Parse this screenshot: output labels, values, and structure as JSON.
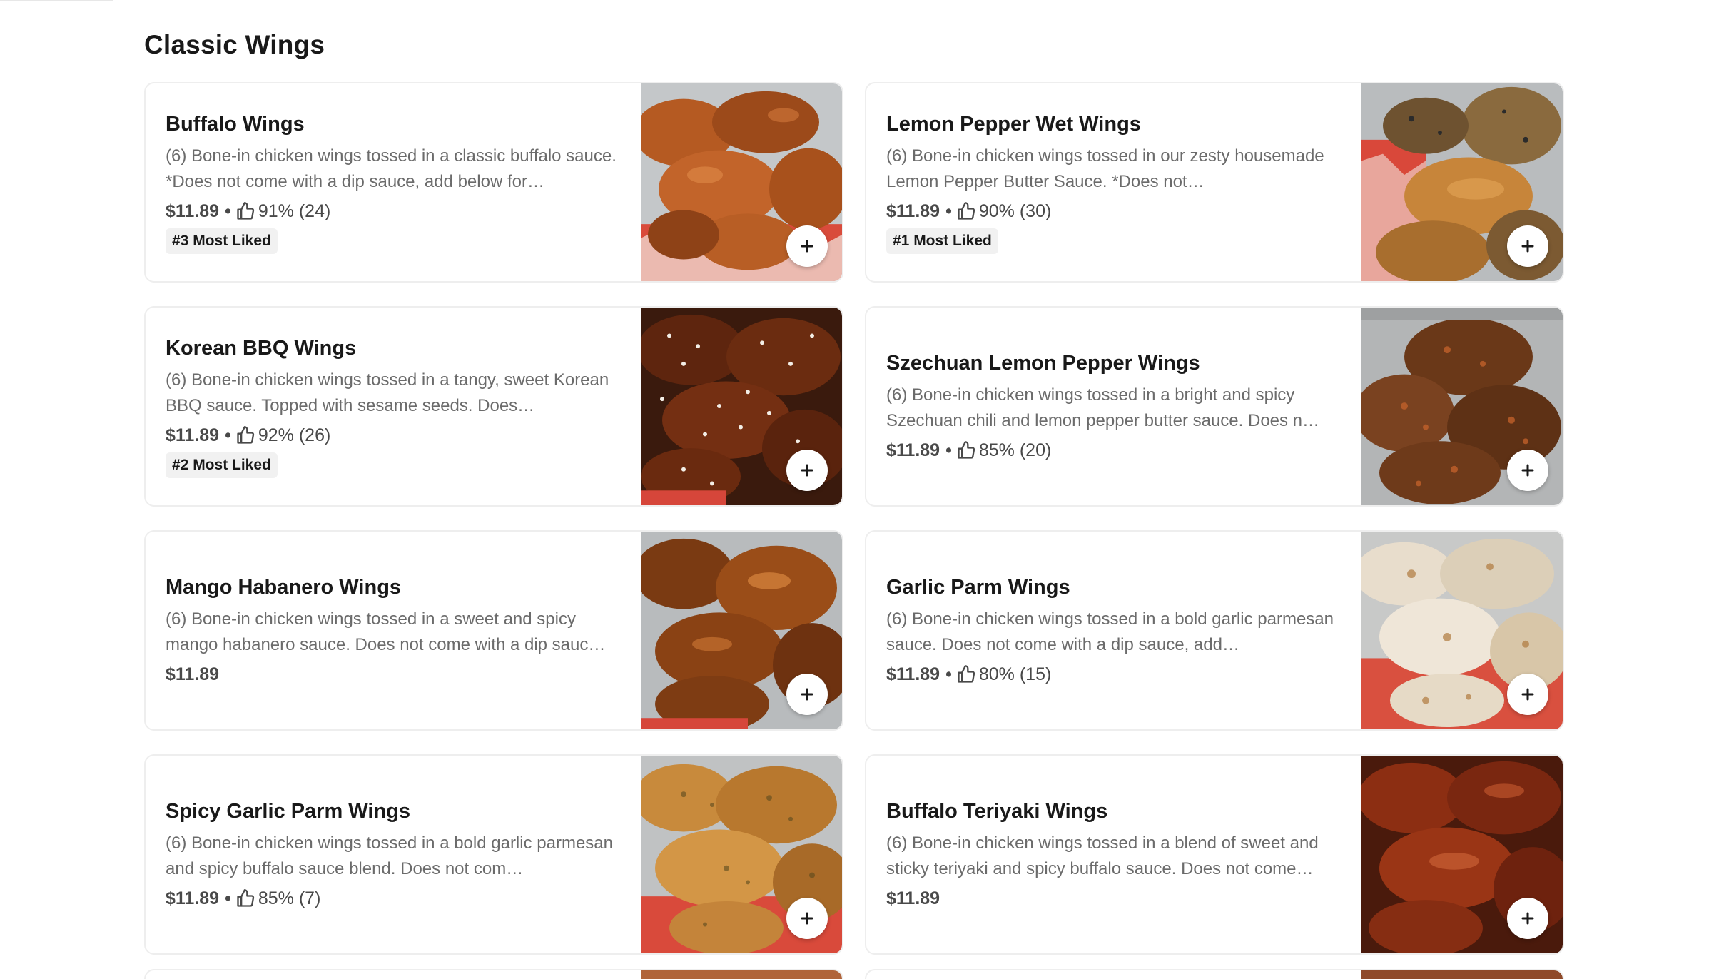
{
  "section": {
    "title": "Classic Wings"
  },
  "icons": {
    "thumb": "thumbs-up-icon",
    "add": "plus-icon"
  },
  "colors": {
    "badge_bg": "#f1f1f1",
    "text_primary": "#191919",
    "text_secondary": "#6b6b6b"
  },
  "items": [
    {
      "name": "Buffalo Wings",
      "description": "(6) Bone-in chicken wings tossed in a classic buffalo sauce. *Does not come with a dip sauce, add below for…",
      "price": "$11.89",
      "rating": "91% (24)",
      "badge": "#3 Most Liked"
    },
    {
      "name": "Lemon Pepper Wet Wings",
      "description": "(6) Bone-in chicken wings tossed in our zesty housemade Lemon Pepper Butter Sauce. *Does not…",
      "price": "$11.89",
      "rating": "90% (30)",
      "badge": "#1 Most Liked"
    },
    {
      "name": "Korean BBQ Wings",
      "description": "(6) Bone-in chicken wings tossed in a tangy, sweet Korean BBQ sauce. Topped with sesame seeds. Does…",
      "price": "$11.89",
      "rating": "92% (26)",
      "badge": "#2 Most Liked"
    },
    {
      "name": "Szechuan Lemon Pepper Wings",
      "description": "(6) Bone-in chicken wings tossed in a bright and spicy Szechuan chili and lemon pepper butter sauce. Does n…",
      "price": "$11.89",
      "rating": "85% (20)",
      "badge": null
    },
    {
      "name": "Mango Habanero Wings",
      "description": "(6) Bone-in chicken wings tossed in a sweet and spicy mango habanero sauce. Does not come with a dip sauc…",
      "price": "$11.89",
      "rating": null,
      "badge": null
    },
    {
      "name": "Garlic Parm Wings",
      "description": "(6) Bone-in chicken wings tossed in a bold garlic parmesan sauce. Does not come with a dip sauce, add…",
      "price": "$11.89",
      "rating": "80% (15)",
      "badge": null
    },
    {
      "name": "Spicy Garlic Parm Wings",
      "description": "(6) Bone-in chicken wings tossed in a bold garlic parmesan and spicy buffalo sauce blend. Does not com…",
      "price": "$11.89",
      "rating": "85% (7)",
      "badge": null
    },
    {
      "name": "Buffalo Teriyaki Wings",
      "description": "(6) Bone-in chicken wings tossed in a blend of sweet and sticky teriyaki and spicy buffalo sauce. Does not come…",
      "price": "$11.89",
      "rating": null,
      "badge": null
    }
  ]
}
